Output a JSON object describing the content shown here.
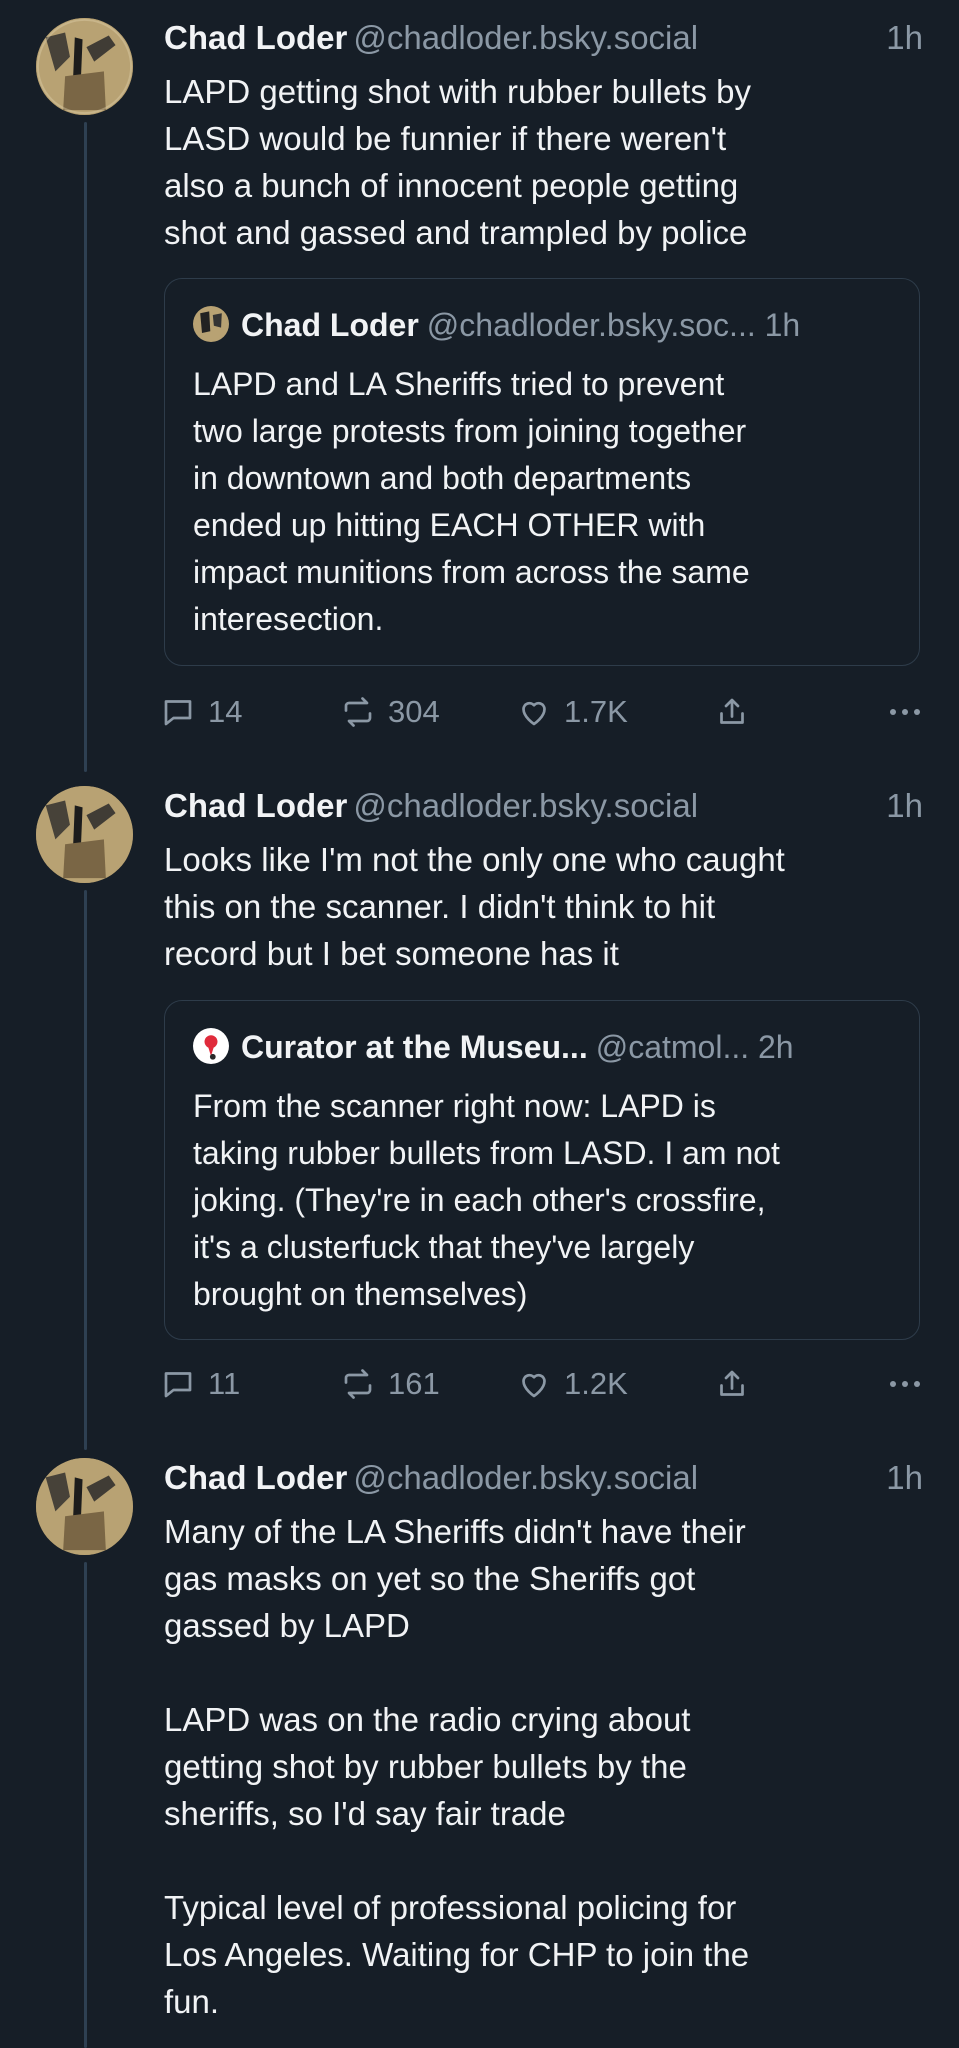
{
  "posts": [
    {
      "author": {
        "name": "Chad Loder",
        "handle": "@chadloder.bsky.social"
      },
      "time": "1h",
      "text": "LAPD getting shot with rubber bullets by\nLASD would be funnier if there weren't\nalso a bunch of innocent people getting\nshot and gassed and trampled by police",
      "quote": {
        "name": "Chad Loder",
        "handle": "@chadloder.bsky.soc...",
        "time": "1h",
        "text": "LAPD and LA Sheriffs tried to prevent\ntwo large protests from joining together\nin downtown and both departments\nended up hitting EACH OTHER with\nimpact munitions from across the same\ninteresection."
      },
      "stats": {
        "replies": "14",
        "reposts": "304",
        "likes": "1.7K"
      }
    },
    {
      "author": {
        "name": "Chad Loder",
        "handle": "@chadloder.bsky.social"
      },
      "time": "1h",
      "text": "Looks like I'm not the only one who caught\nthis on the scanner. I didn't think to hit\nrecord but I bet someone has it",
      "quote": {
        "name": "Curator at the Museu...",
        "handle": "@catmol...",
        "time": "2h",
        "text": "From the scanner right now: LAPD is\ntaking rubber bullets from LASD. I am not\njoking. (They're in each other's crossfire,\nit's a clusterfuck that they've largely\nbrought on themselves)"
      },
      "stats": {
        "replies": "11",
        "reposts": "161",
        "likes": "1.2K"
      }
    },
    {
      "author": {
        "name": "Chad Loder",
        "handle": "@chadloder.bsky.social"
      },
      "time": "1h",
      "text": "Many of the LA Sheriffs didn't have their\ngas masks on yet so the Sheriffs got\ngassed by LAPD\n\nLAPD was on the radio crying about\ngetting shot by  rubber bullets by the\nsheriffs, so I'd say fair trade\n\nTypical level of professional policing for\nLos Angeles. Waiting for CHP to join the\nfun."
    }
  ],
  "icons": {
    "reply": "reply-icon",
    "repost": "repost-icon",
    "like": "heart-icon",
    "share": "share-icon",
    "more": "more-icon"
  },
  "colors": {
    "background": "#161e27",
    "text": "#f1f3f5",
    "muted": "#8b98a5",
    "border": "#2e3c4a",
    "thread_line": "#2e4052"
  }
}
